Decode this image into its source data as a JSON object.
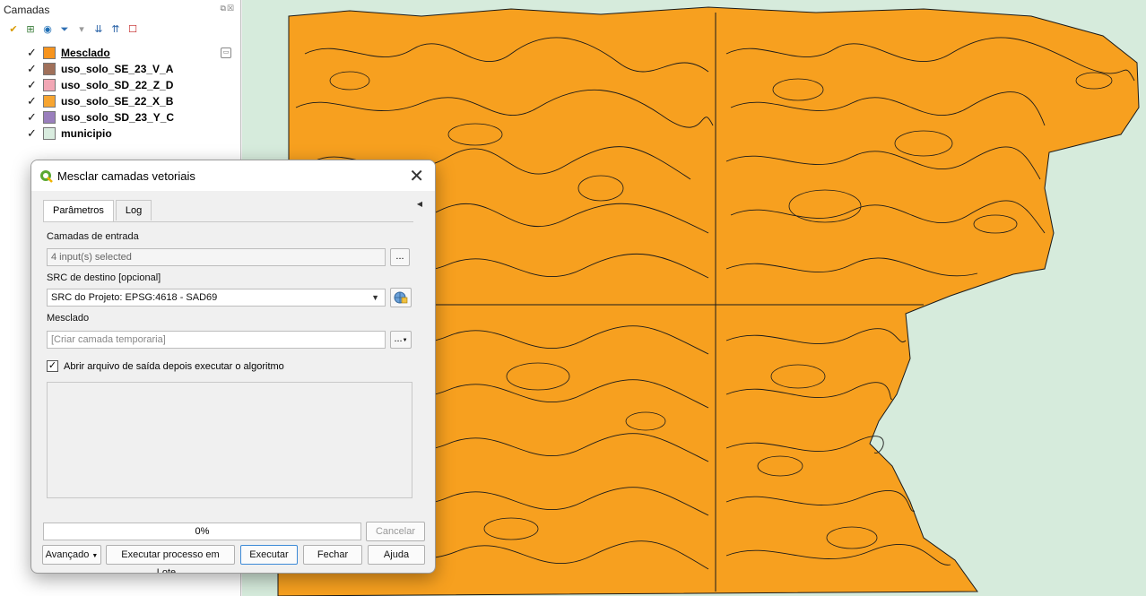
{
  "layers_panel": {
    "title": "Camadas",
    "layers": [
      {
        "name": "Mesclado",
        "color": "#f7941d",
        "active": true
      },
      {
        "name": "uso_solo_SE_23_V_A",
        "color": "#a0705a",
        "active": false
      },
      {
        "name": "uso_solo_SD_22_Z_D",
        "color": "#f2a7b5",
        "active": false
      },
      {
        "name": "uso_solo_SE_22_X_B",
        "color": "#f7a531",
        "active": false
      },
      {
        "name": "uso_solo_SD_23_Y_C",
        "color": "#9a7fbd",
        "active": false
      },
      {
        "name": "municipio",
        "color": "#d9ecdf",
        "active": false
      }
    ]
  },
  "map": {
    "background_color": "#d6ebdc",
    "fill_color": "#f7a01f",
    "line_color": "#1a1a1a"
  },
  "dialog": {
    "title": "Mesclar camadas vetoriais",
    "tabs": {
      "params": "Parâmetros",
      "log": "Log"
    },
    "input_layers_label": "Camadas de entrada",
    "input_layers_value": "4 input(s) selected",
    "crs_label": "SRC de destino [opcional]",
    "crs_value": "SRC do Projeto: EPSG:4618 - SAD69",
    "output_label": "Mesclado",
    "output_placeholder": "[Criar camada temporaria]",
    "open_output_label": "Abrir arquivo de saída depois executar o algoritmo",
    "progress_text": "0%",
    "buttons": {
      "cancel": "Cancelar",
      "advanced": "Avançado",
      "batch": "Executar processo em Lote...",
      "run": "Executar",
      "close": "Fechar",
      "help": "Ajuda"
    },
    "ellipsis": "..."
  }
}
